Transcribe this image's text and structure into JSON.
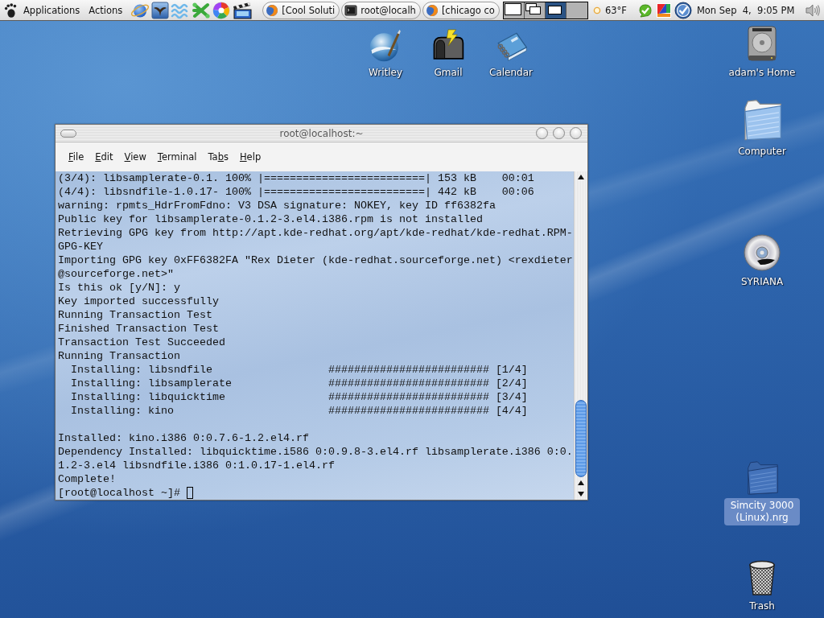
{
  "top_panel": {
    "menus": [
      "Applications",
      "Actions"
    ],
    "tasks": [
      {
        "label": "[Cool Soluti",
        "kind": "browser"
      },
      {
        "label": "root@localh",
        "kind": "terminal"
      },
      {
        "label": "[chicago co",
        "kind": "browser"
      }
    ],
    "workspaces": [
      {
        "selected": false
      },
      {
        "selected": false
      },
      {
        "selected": true
      },
      {
        "selected": false
      }
    ],
    "weather": "63°F",
    "clock": "Mon Sep  4,  9:05 PM"
  },
  "desktop_icons": [
    {
      "label": "Writley",
      "kind": "writer",
      "selected": false
    },
    {
      "label": "Gmail",
      "kind": "mail",
      "selected": false
    },
    {
      "label": "Calendar",
      "kind": "calendar",
      "selected": false
    },
    {
      "label": "adam's Home",
      "kind": "home",
      "selected": false
    },
    {
      "label": "Computer",
      "kind": "computer",
      "selected": false
    },
    {
      "label": "SYRIANA",
      "kind": "dvd",
      "selected": false
    },
    {
      "label": "Simcity 3000 (Linux).nrg",
      "kind": "image",
      "selected": true
    },
    {
      "label": "Trash",
      "kind": "trash",
      "selected": false
    }
  ],
  "terminal": {
    "title": "root@localhost:~",
    "menu": [
      {
        "key": "F",
        "after": "ile"
      },
      {
        "key": "E",
        "after": "dit"
      },
      {
        "key": "V",
        "after": "iew"
      },
      {
        "key": "T",
        "after": "erminal"
      },
      {
        "before": "Ta",
        "key": "b",
        "after": "s"
      },
      {
        "key": "H",
        "after": "elp"
      }
    ],
    "blocks": [
      [
        "(3/4): libsamplerate-0.1. 100% |=========================| 153 kB    00:01",
        "(4/4): libsndfile-1.0.17- 100% |=========================| 442 kB    00:06",
        "warning: rpmts_HdrFromFdno: V3 DSA signature: NOKEY, key ID ff6382fa",
        "Public key for libsamplerate-0.1.2-3.el4.i386.rpm is not installed",
        "Retrieving GPG key from http://apt.kde-redhat.org/apt/kde-redhat/kde-redhat.RPM-",
        "GPG-KEY",
        "Importing GPG key 0xFF6382FA \"Rex Dieter (kde-redhat.sourceforge.net) <rexdieter",
        "@sourceforge.net>\"",
        "Is this ok [y/N]: y",
        "Key imported successfully",
        "Running Transaction Test",
        "Finished Transaction Test",
        "Transaction Test Succeeded",
        "Running Transaction",
        "  Installing: libsndfile                  ######################### [1/4]",
        "  Installing: libsamplerate               ######################### [2/4]",
        "  Installing: libquicktime                ######################### [3/4]",
        "  Installing: kino                        ######################### [4/4]"
      ],
      [
        "Installed: kino.i386 0:0.7.6-1.2.el4.rf",
        "Dependency Installed: libquicktime.i586 0:0.9.8-3.el4.rf libsamplerate.i386 0:0.",
        "1.2-3.el4 libsndfile.i386 0:1.0.17-1.el4.rf",
        "Complete!"
      ]
    ],
    "prompt": "[root@localhost ~]#"
  }
}
